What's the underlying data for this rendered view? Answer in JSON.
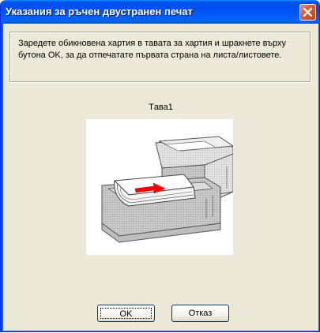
{
  "window": {
    "title": "Указания за ръчен двустранен печат"
  },
  "message": {
    "line1": "Заредете обикновена хартия в тавата за хартия и шракнете върху",
    "line2": "бутона OK, за да отпечатате първата страна на листа/листовете."
  },
  "tray": {
    "label": "Tава1"
  },
  "buttons": {
    "ok_label": "OK",
    "cancel_label": "Отказ"
  },
  "colors": {
    "titlebar": "#0055e5",
    "dialog_bg": "#ece9d8",
    "close_button": "#d65a34",
    "arrow": "#ff0000"
  },
  "icons": {
    "close": "close-icon",
    "illustration": "paper-tray-illustration"
  }
}
